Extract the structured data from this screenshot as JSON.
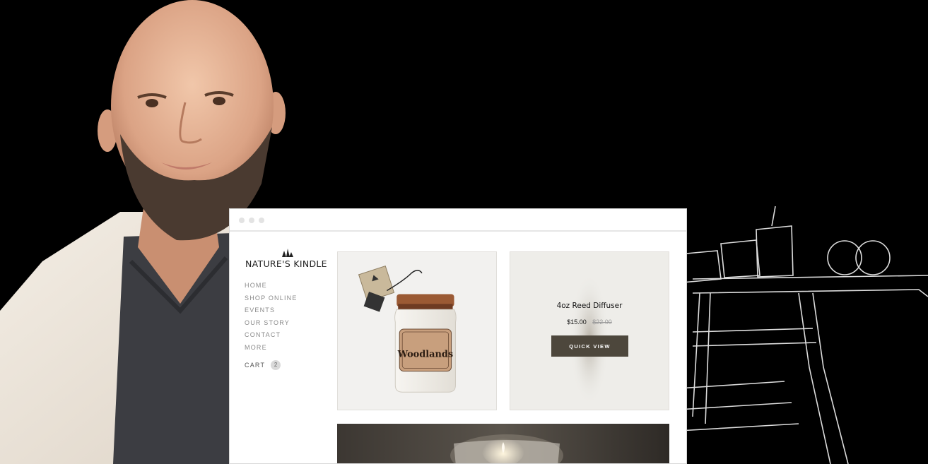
{
  "site": {
    "brand": "NATURE'S KINDLE",
    "nav": [
      "HOME",
      "SHOP ONLINE",
      "EVENTS",
      "OUR STORY",
      "CONTACT",
      "MORE"
    ],
    "cart_label": "CART",
    "cart_count": "2"
  },
  "products": [
    {
      "jar_label": "Woodlands",
      "image": "candle-jar"
    },
    {
      "title": "4oz Reed Diffuser",
      "price": "$15.00",
      "old_price": "$22.00",
      "button": "QUICK VIEW"
    }
  ],
  "colors": {
    "accent_button": "#4d473c",
    "background": "#000000"
  },
  "icons": [
    "tree-logo-icon",
    "window-dot-icon"
  ]
}
